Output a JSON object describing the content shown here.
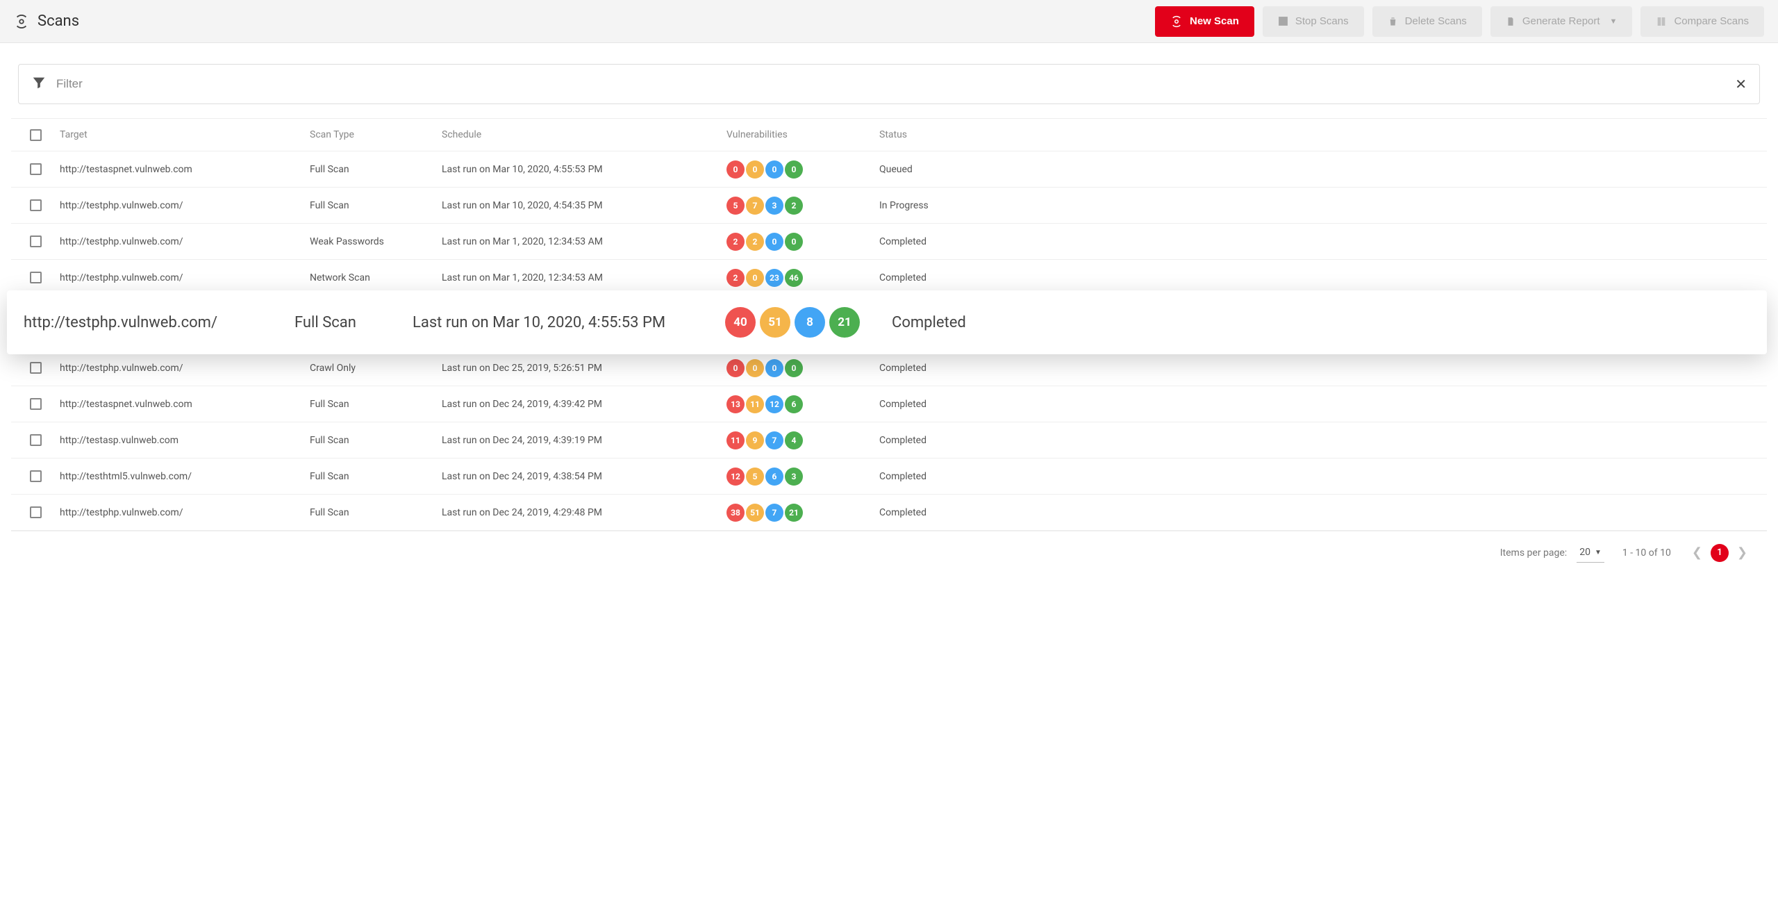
{
  "header": {
    "title": "Scans",
    "actions": {
      "new_scan": "New Scan",
      "stop_scans": "Stop Scans",
      "delete_scans": "Delete Scans",
      "generate_report": "Generate Report",
      "compare_scans": "Compare Scans"
    }
  },
  "filter": {
    "placeholder": "Filter"
  },
  "columns": {
    "target": "Target",
    "scan_type": "Scan Type",
    "schedule": "Schedule",
    "vulnerabilities": "Vulnerabilities",
    "status": "Status"
  },
  "rows": [
    {
      "target": "http://testaspnet.vulnweb.com",
      "type": "Full Scan",
      "schedule": "Last run on Mar 10, 2020, 4:55:53 PM",
      "v": [
        0,
        0,
        0,
        0
      ],
      "status": "Queued"
    },
    {
      "target": "http://testphp.vulnweb.com/",
      "type": "Full Scan",
      "schedule": "Last run on Mar 10, 2020, 4:54:35 PM",
      "v": [
        5,
        7,
        3,
        2
      ],
      "status": "In Progress"
    },
    {
      "target": "http://testphp.vulnweb.com/",
      "type": "Weak Passwords",
      "schedule": "Last run on Mar 1, 2020, 12:34:53 AM",
      "v": [
        2,
        2,
        0,
        0
      ],
      "status": "Completed"
    },
    {
      "target": "http://testphp.vulnweb.com/",
      "type": "Network Scan",
      "schedule": "Last run on Mar 1, 2020, 12:34:53 AM",
      "v": [
        2,
        0,
        23,
        46
      ],
      "status": "Completed"
    },
    {
      "target": "http://testphp.vulnweb.com/",
      "type": "Crawl Only",
      "schedule": "Last run on Dec 25, 2019, 5:26:51 PM",
      "v": [
        0,
        0,
        0,
        0
      ],
      "status": "Completed"
    },
    {
      "target": "http://testaspnet.vulnweb.com",
      "type": "Full Scan",
      "schedule": "Last run on Dec 24, 2019, 4:39:42 PM",
      "v": [
        13,
        11,
        12,
        6
      ],
      "status": "Completed"
    },
    {
      "target": "http://testasp.vulnweb.com",
      "type": "Full Scan",
      "schedule": "Last run on Dec 24, 2019, 4:39:19 PM",
      "v": [
        11,
        9,
        7,
        4
      ],
      "status": "Completed"
    },
    {
      "target": "http://testhtml5.vulnweb.com/",
      "type": "Full Scan",
      "schedule": "Last run on Dec 24, 2019, 4:38:54 PM",
      "v": [
        12,
        5,
        6,
        3
      ],
      "status": "Completed"
    },
    {
      "target": "http://testphp.vulnweb.com/",
      "type": "Full Scan",
      "schedule": "Last run on Dec 24, 2019, 4:29:48 PM",
      "v": [
        38,
        51,
        7,
        21
      ],
      "status": "Completed"
    }
  ],
  "highlight": {
    "target": "http://testphp.vulnweb.com/",
    "type": "Full Scan",
    "schedule": "Last run on Mar 10, 2020, 4:55:53 PM",
    "v": [
      40,
      51,
      8,
      21
    ],
    "status": "Completed"
  },
  "pagination": {
    "items_per_page_label": "Items per page:",
    "items_per_page_value": "20",
    "range": "1 - 10 of 10",
    "current": "1"
  }
}
